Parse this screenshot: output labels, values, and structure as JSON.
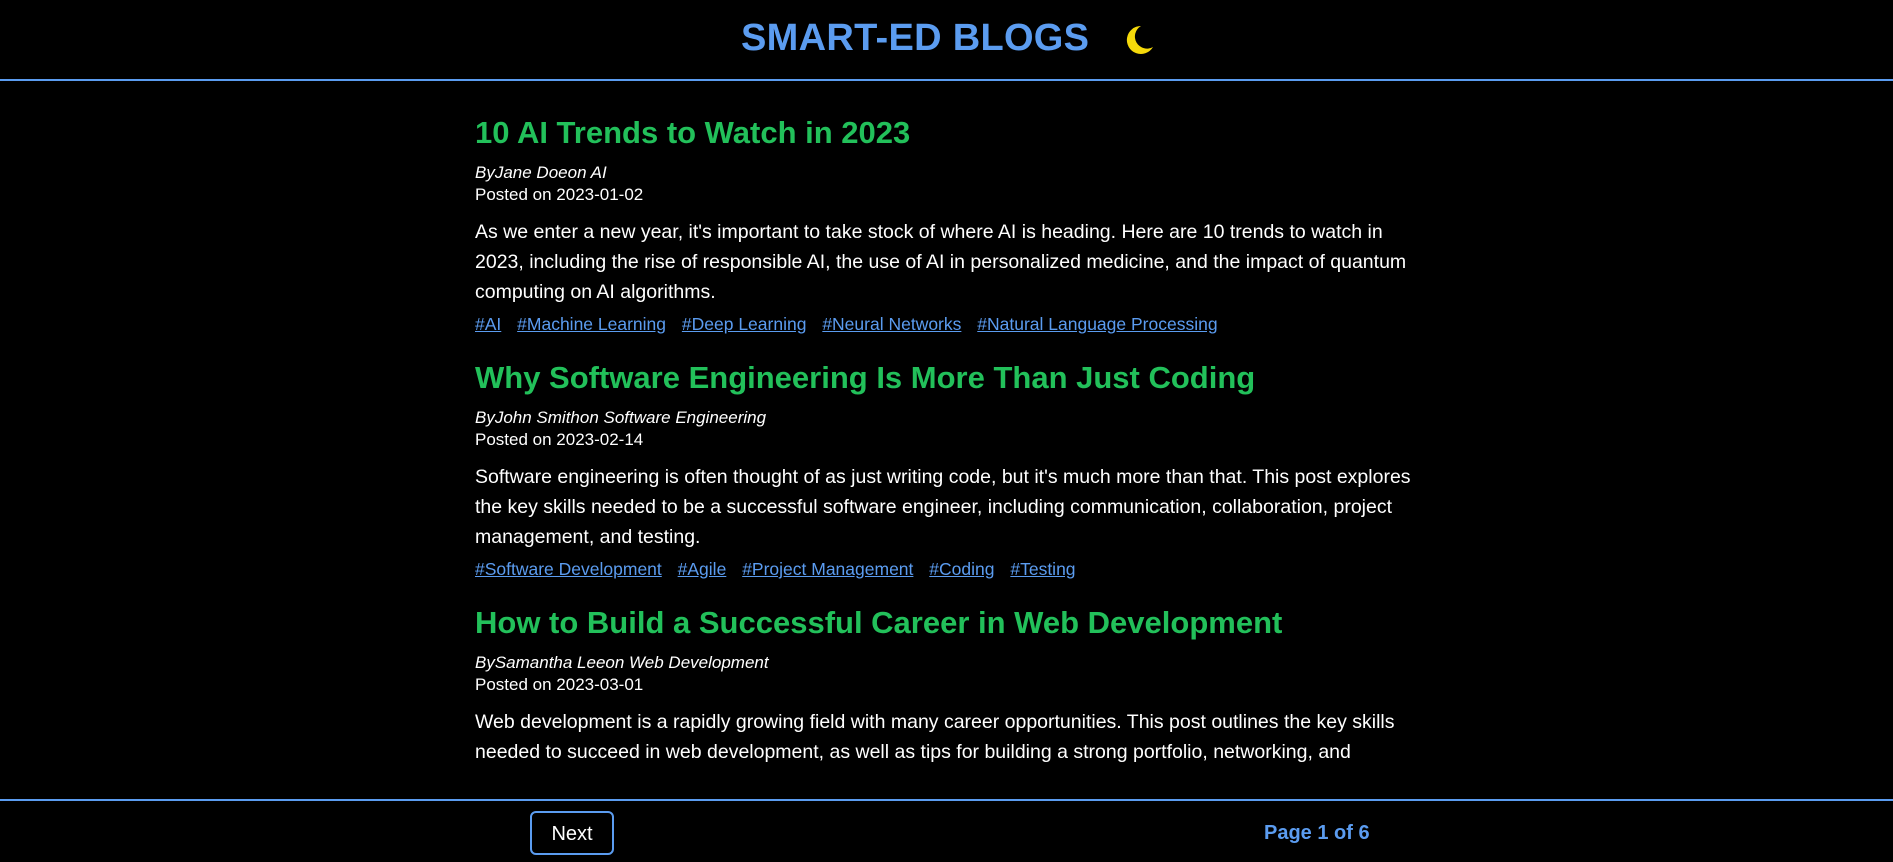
{
  "header": {
    "title": "SMART-ED BLOGS",
    "theme_icon": "moon-icon",
    "moon_color": "#f5d90a"
  },
  "colors": {
    "accent": "#5b9cf0",
    "post_title": "#22c05a",
    "background": "#000000",
    "text": "#ffffff"
  },
  "posts": [
    {
      "title": "10 AI Trends to Watch in 2023",
      "meta": "ByJane Doeon AI",
      "date": "Posted on 2023-01-02",
      "body": "As we enter a new year, it's important to take stock of where AI is heading. Here are 10 trends to watch in 2023, including the rise of responsible AI, the use of AI in personalized medicine, and the impact of quantum computing on AI algorithms.",
      "tags": [
        "#AI",
        "#Machine Learning",
        "#Deep Learning",
        "#Neural Networks",
        "#Natural Language Processing"
      ]
    },
    {
      "title": "Why Software Engineering Is More Than Just Coding",
      "meta": "ByJohn Smithon Software Engineering",
      "date": "Posted on 2023-02-14",
      "body": "Software engineering is often thought of as just writing code, but it's much more than that. This post explores the key skills needed to be a successful software engineer, including communication, collaboration, project management, and testing.",
      "tags": [
        "#Software Development",
        "#Agile",
        "#Project Management",
        "#Coding",
        "#Testing"
      ]
    },
    {
      "title": "How to Build a Successful Career in Web Development",
      "meta": "BySamantha Leeon Web Development",
      "date": "Posted on 2023-03-01",
      "body": "Web development is a rapidly growing field with many career opportunities. This post outlines the key skills needed to succeed in web development, as well as tips for building a strong portfolio, networking, and",
      "tags": []
    }
  ],
  "footer": {
    "next_label": "Next",
    "page_indicator": "Page 1 of 6"
  }
}
